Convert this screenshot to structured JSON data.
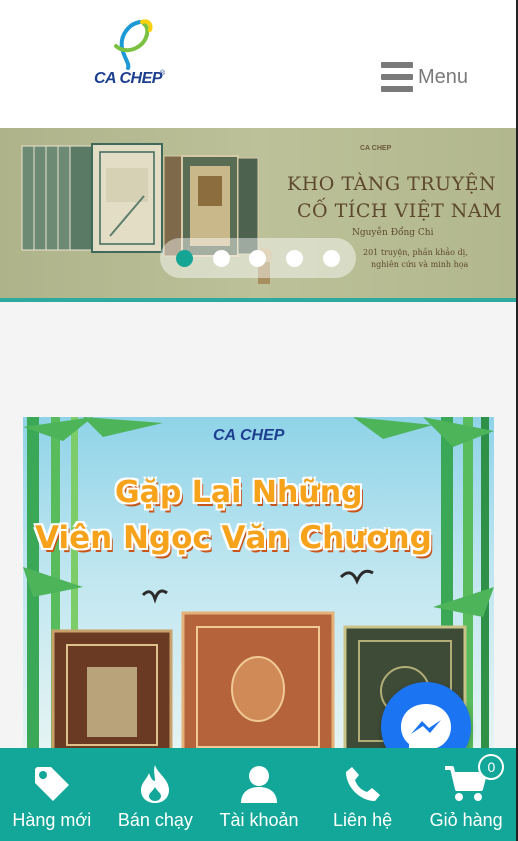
{
  "header": {
    "logo_text": "CA CHEP",
    "logo_mark": "®",
    "menu_label": "Menu"
  },
  "slider": {
    "slide_logo": "CA CHEP",
    "title_line1": "KHO TÀNG TRUYỆN",
    "title_line2": "CỐ TÍCH VIỆT NAM",
    "author": "Nguyễn Đổng Chi",
    "note_line1": "201 truyện, phần khảo dị,",
    "note_line2": "nghiên cứu và minh họa",
    "dots": 5,
    "active_index": 0
  },
  "promo": {
    "logo": "CA CHEP",
    "line1": "Gặp Lại Những",
    "line2": "Viên Ngọc Văn Chương"
  },
  "bottom_nav": {
    "items": [
      {
        "label": "Hàng mới",
        "icon": "tag-icon"
      },
      {
        "label": "Bán chạy",
        "icon": "fire-icon"
      },
      {
        "label": "Tài khoản",
        "icon": "user-icon"
      },
      {
        "label": "Liên hệ",
        "icon": "phone-icon"
      },
      {
        "label": "Giỏ hàng",
        "icon": "cart-icon"
      }
    ],
    "cart_count": "0"
  },
  "colors": {
    "accent": "#13a79a",
    "brand_blue": "#1d3f8f",
    "messenger": "#1b74f2"
  }
}
